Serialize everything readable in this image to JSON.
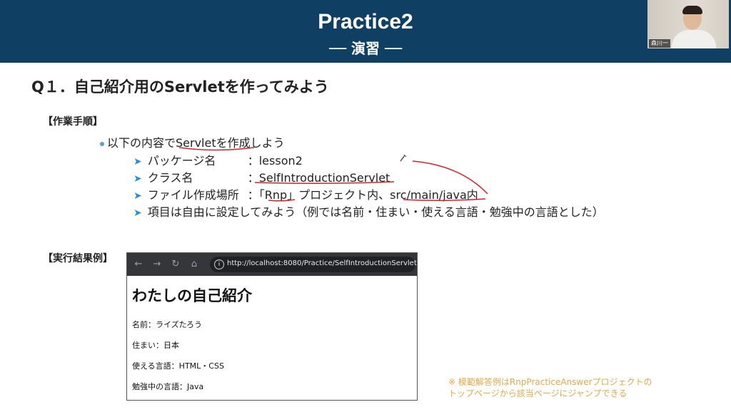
{
  "header": {
    "title": "Practice2",
    "subtitle": "── 演習 ──"
  },
  "webcam": {
    "name": "森川一"
  },
  "question": {
    "title": "Q１．自己紹介用のServletを作ってみよう"
  },
  "steps_section": {
    "label": "【作業手順】",
    "bullet": "以下の内容でServletを作成しよう",
    "items": [
      {
        "key": "パッケージ名",
        "value": "：lesson2"
      },
      {
        "key": "クラス名",
        "value": "：SelfIntroductionServlet"
      },
      {
        "key": "ファイル作成場所",
        "value": "：「Rnp」プロジェクト内、src/main/java内"
      },
      {
        "key": "",
        "value": "項目は自由に設定してみよう（例では名前・住まい・使える言語・勉強中の言語とした）"
      }
    ]
  },
  "result_section": {
    "label": "【実行結果例】"
  },
  "browser": {
    "url": "http://localhost:8080/Practice/SelfIntroductionServlet",
    "heading": "わたしの自己紹介",
    "lines": [
      "名前：ライズたろう",
      "住まい：日本",
      "使える言語：HTML・CSS",
      "勉強中の言語：Java"
    ]
  },
  "note": {
    "line1": "※ 模範解答例はRnpPracticeAnswerプロジェクトの",
    "line2": "トップページから該当ページにジャンプできる"
  },
  "colors": {
    "header_bg": "#0f3f63",
    "ink_red": "#d4222a",
    "arrow_blue": "#2a8fd6",
    "note_orange": "#e0a84a"
  },
  "icons": [
    "back-icon",
    "forward-icon",
    "reload-icon",
    "home-icon",
    "info-icon",
    "pencil-icon"
  ]
}
